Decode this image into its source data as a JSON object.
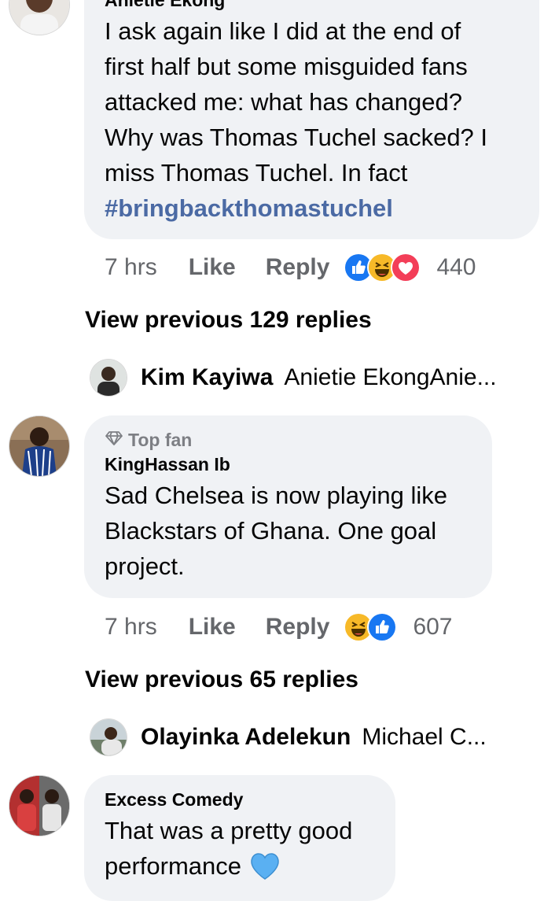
{
  "comments": [
    {
      "author": "Anietie Ekong",
      "text_lines": [
        "I ask again like I did at the end of",
        "first half but some misguided fans",
        "attacked me: what has changed?",
        "Why was Thomas Tuchel sacked? I",
        "miss Thomas Tuchel. In fact"
      ],
      "hashtag": "#bringbackthomastuchel",
      "time": "7 hrs",
      "like_label": "Like",
      "reply_label": "Reply",
      "reactions": [
        "like",
        "haha",
        "love"
      ],
      "reaction_count": "440",
      "view_previous": "View previous 129 replies",
      "latest_reply": {
        "name": "Kim Kayiwa",
        "snippet": "Anietie EkongAnie..."
      }
    },
    {
      "badge": "Top fan",
      "author": "KingHassan Ib",
      "text_lines": [
        "Sad Chelsea is now playing like",
        "Blackstars of Ghana. One goal",
        "project."
      ],
      "time": "7 hrs",
      "like_label": "Like",
      "reply_label": "Reply",
      "reactions": [
        "haha",
        "like"
      ],
      "reaction_count": "607",
      "view_previous": "View previous 65 replies",
      "latest_reply": {
        "name": "Olayinka Adelekun",
        "snippet": "Michael C..."
      }
    },
    {
      "author": "Excess Comedy",
      "text_lines": [
        "That was a pretty good",
        "performance"
      ],
      "emoji": "blue-heart"
    }
  ],
  "colors": {
    "bubble": "#f0f2f5",
    "hashtag": "#4b6aa4",
    "meta": "#65676b",
    "like_reaction": "#1877f2",
    "love_reaction": "#f33e58",
    "haha_reaction": "#f7b928",
    "blue_heart": "#5ab0f2"
  }
}
